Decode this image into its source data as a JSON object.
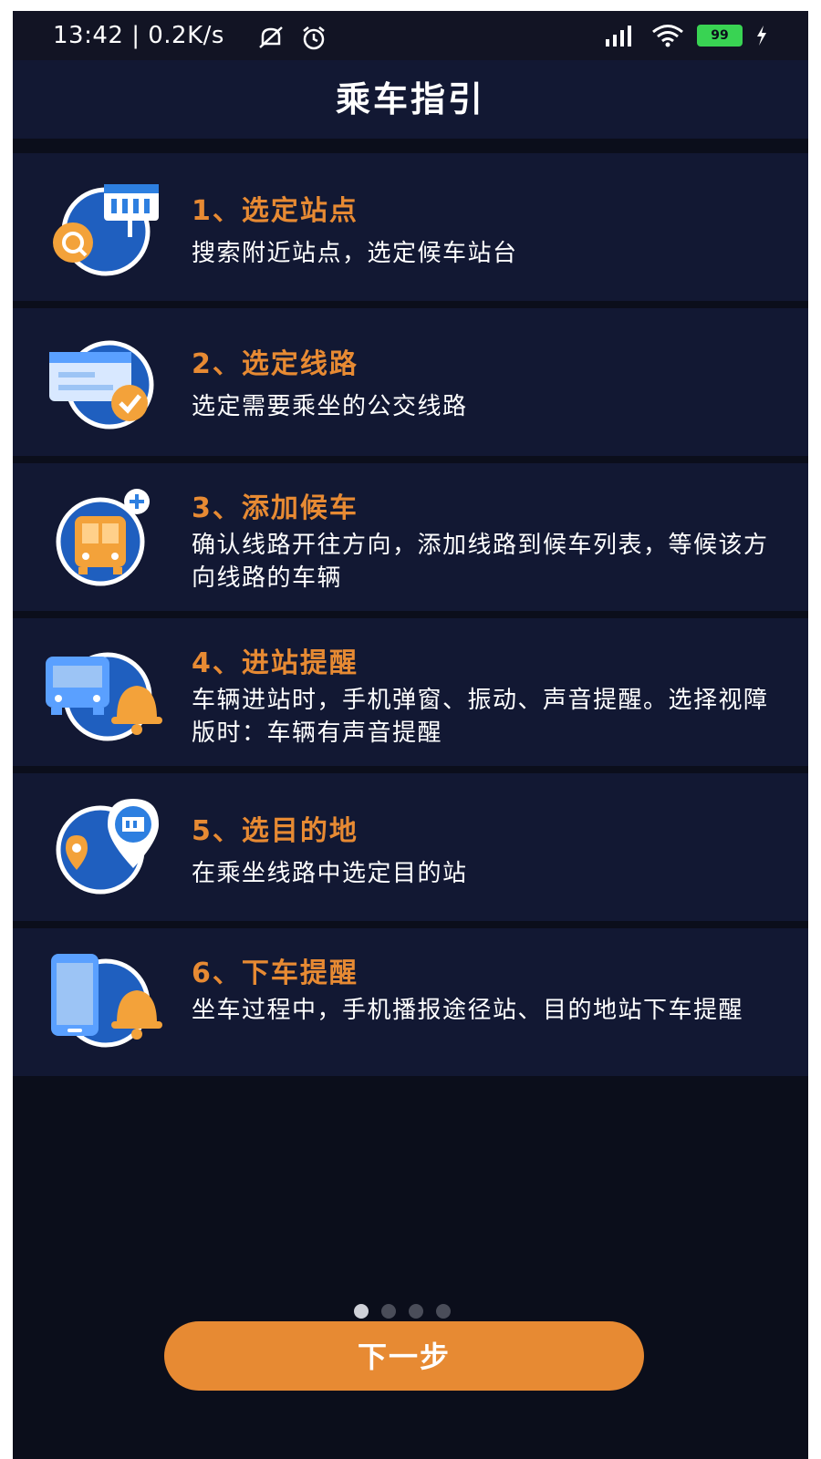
{
  "status_bar": {
    "time": "13:42 | 0.2K/s",
    "battery": "99"
  },
  "header": {
    "title": "乘车指引"
  },
  "guide_items": [
    {
      "title": "1、选定站点",
      "desc": "搜索附近站点，选定候车站台",
      "icon": "station-search-icon"
    },
    {
      "title": "2、选定线路",
      "desc": "选定需要乘坐的公交线路",
      "icon": "route-check-icon"
    },
    {
      "title": "3、添加候车",
      "desc": "确认线路开往方向，添加线路到候车列表，等候该方向线路的车辆",
      "icon": "bus-add-icon"
    },
    {
      "title": "4、进站提醒",
      "desc": "车辆进站时，手机弹窗、振动、声音提醒。选择视障版时：车辆有声音提醒",
      "icon": "bus-bell-icon"
    },
    {
      "title": "5、选目的地",
      "desc": "在乘坐线路中选定目的站",
      "icon": "destination-pin-icon"
    },
    {
      "title": "6、下车提醒",
      "desc": "坐车过程中，手机播报途径站、目的地站下车提醒",
      "icon": "phone-bell-icon"
    }
  ],
  "pager": {
    "total": 4,
    "active": 1
  },
  "footer": {
    "next_label": "下一步"
  },
  "colors": {
    "accent": "#e78a33",
    "background": "#0b0e1b",
    "card": "#121833",
    "icon_blue": "#2d7fe0"
  }
}
